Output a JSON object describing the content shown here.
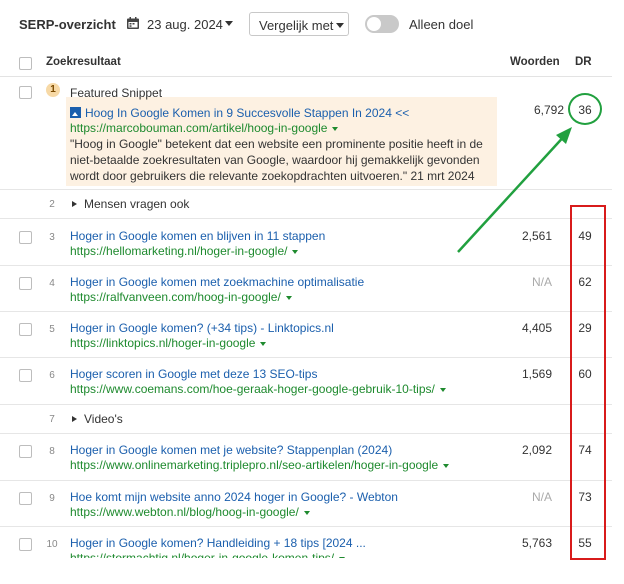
{
  "topbar": {
    "title": "SERP-overzicht",
    "date": "23 aug. 2024",
    "compare_label": "Vergelijk met",
    "toggle_label": "Alleen doel",
    "toggle_on": false
  },
  "table_header": {
    "result": "Zoekresultaat",
    "words": "Woorden",
    "dr": "DR"
  },
  "featured": {
    "rank": "1",
    "label": "Featured Snippet",
    "title": "Hoog In Google Komen in 9 Succesvolle Stappen In 2024 <<",
    "url": "https://marcobouman.com/artikel/hoog-in-google",
    "text": "\"Hoog in Google\" betekent dat een website een prominente positie heeft in de niet-betaalde zoekresultaten van Google, waardoor hij gemakkelijk gevonden wordt door gebruikers die relevante zoekopdrachten uitvoeren.\" 21 mrt 2024",
    "words": "6,792",
    "dr": "36"
  },
  "groups": [
    {
      "rank": "2",
      "label": "Mensen vragen ook"
    },
    {
      "rank": "7",
      "label": "Video's"
    }
  ],
  "results": [
    {
      "rank": "3",
      "title": "Hoger in Google komen en blijven in 11 stappen",
      "url": "https://hellomarketing.nl/hoger-in-google/",
      "words": "2,561",
      "dr": "49"
    },
    {
      "rank": "4",
      "title": "Hoger in Google komen met zoekmachine optimalisatie",
      "url": "https://ralfvanveen.com/hoog-in-google/",
      "words": "N/A",
      "dr": "62"
    },
    {
      "rank": "5",
      "title": "Hoger in Google komen? (+34 tips) - Linktopics.nl",
      "url": "https://linktopics.nl/hoger-in-google",
      "words": "4,405",
      "dr": "29"
    },
    {
      "rank": "6",
      "title": "Hoger scoren in Google met deze 13 SEO-tips",
      "url": "https://www.coemans.com/hoe-geraak-hoger-google-gebruik-10-tips/",
      "words": "1,569",
      "dr": "60"
    },
    {
      "rank": "8",
      "title": "Hoger in Google komen met je website? Stappenplan (2024)",
      "url": "https://www.onlinemarketing.triplepro.nl/seo-artikelen/hoger-in-google",
      "words": "2,092",
      "dr": "74"
    },
    {
      "rank": "9",
      "title": "Hoe komt mijn website anno 2024 hoger in Google? - Webton",
      "url": "https://www.webton.nl/blog/hoog-in-google/",
      "words": "N/A",
      "dr": "73"
    },
    {
      "rank": "10",
      "title": "Hoger in Google komen? Handleiding + 18 tips [2024 ...",
      "url": "https://stormachtig.nl/hoger-in-google-komen-tips/",
      "words": "5,763",
      "dr": "55"
    }
  ],
  "colors": {
    "link": "#1b5fad",
    "url": "#1e8a2e",
    "snippet_bg": "#fdf1e2",
    "annotation_green": "#21a03f",
    "annotation_red": "#d81b1b"
  }
}
